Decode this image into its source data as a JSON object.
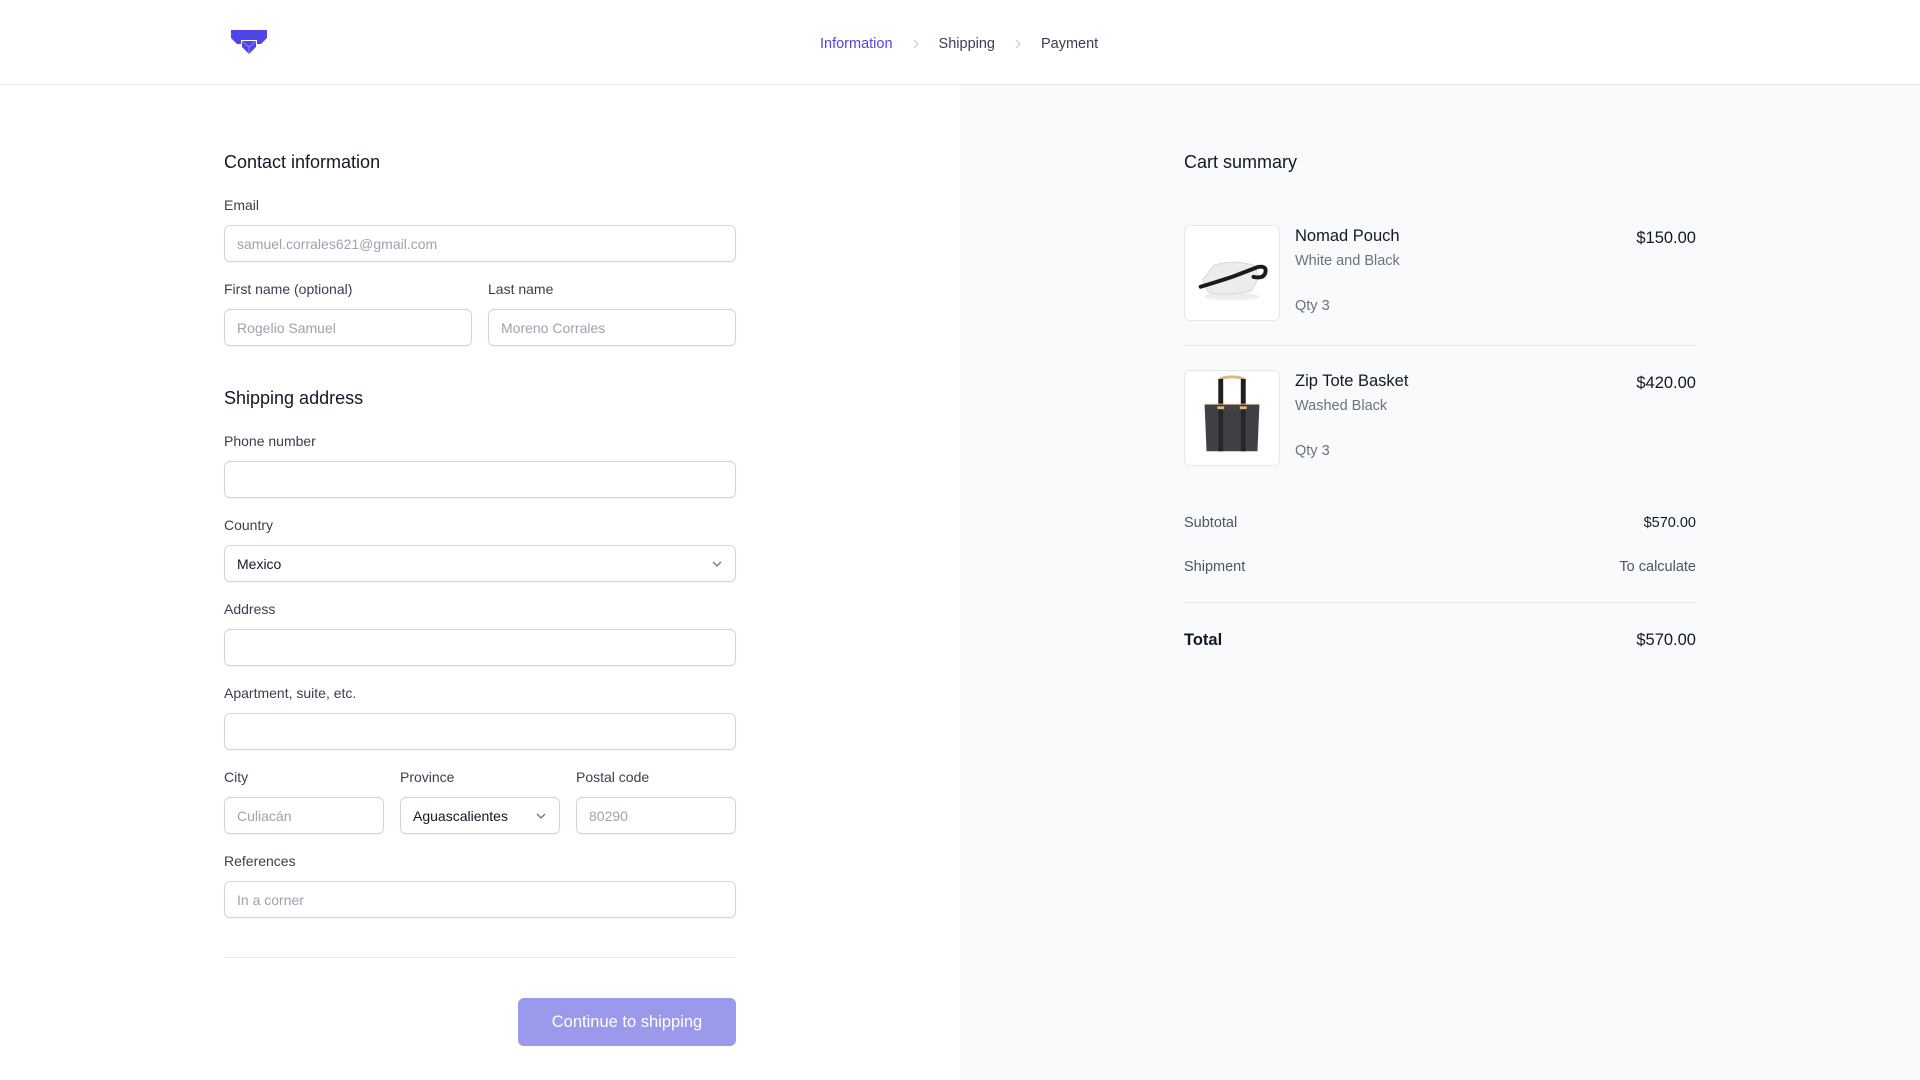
{
  "brand": {
    "logo": "brand-logo-icon",
    "accent": "#4f46e5",
    "button_color": "#9a99ec"
  },
  "steps": [
    {
      "label": "Information",
      "active": true
    },
    {
      "label": "Shipping",
      "active": false
    },
    {
      "label": "Payment",
      "active": false
    }
  ],
  "contact": {
    "title": "Contact information",
    "email": {
      "label": "Email",
      "placeholder": "samuel.corrales621@gmail.com",
      "value": ""
    },
    "first_name": {
      "label": "First name (optional)",
      "placeholder": "Rogelio Samuel",
      "value": ""
    },
    "last_name": {
      "label": "Last name",
      "placeholder": "Moreno Corrales",
      "value": ""
    }
  },
  "shipping": {
    "title": "Shipping address",
    "phone": {
      "label": "Phone number",
      "placeholder": "",
      "value": ""
    },
    "country": {
      "label": "Country",
      "value": "Mexico"
    },
    "address": {
      "label": "Address",
      "placeholder": "",
      "value": ""
    },
    "apartment": {
      "label": "Apartment, suite, etc.",
      "placeholder": "",
      "value": ""
    },
    "city": {
      "label": "City",
      "placeholder": "Culiacán",
      "value": ""
    },
    "province": {
      "label": "Province",
      "value": "Aguascalientes"
    },
    "postal_code": {
      "label": "Postal code",
      "placeholder": "80290",
      "value": ""
    },
    "references": {
      "label": "References",
      "placeholder": "In a corner",
      "value": ""
    }
  },
  "actions": {
    "continue_label": "Continue to shipping"
  },
  "cart": {
    "title": "Cart summary",
    "items": [
      {
        "name": "Nomad Pouch",
        "variant": "White and Black",
        "qty": "Qty 3",
        "price": "$150.00",
        "image": "white-pouch-image"
      },
      {
        "name": "Zip Tote Basket",
        "variant": "Washed Black",
        "qty": "Qty 3",
        "price": "$420.00",
        "image": "black-tote-image"
      }
    ],
    "subtotal_label": "Subtotal",
    "subtotal": "$570.00",
    "shipment_label": "Shipment",
    "shipment": "To calculate",
    "total_label": "Total",
    "total": "$570.00"
  }
}
